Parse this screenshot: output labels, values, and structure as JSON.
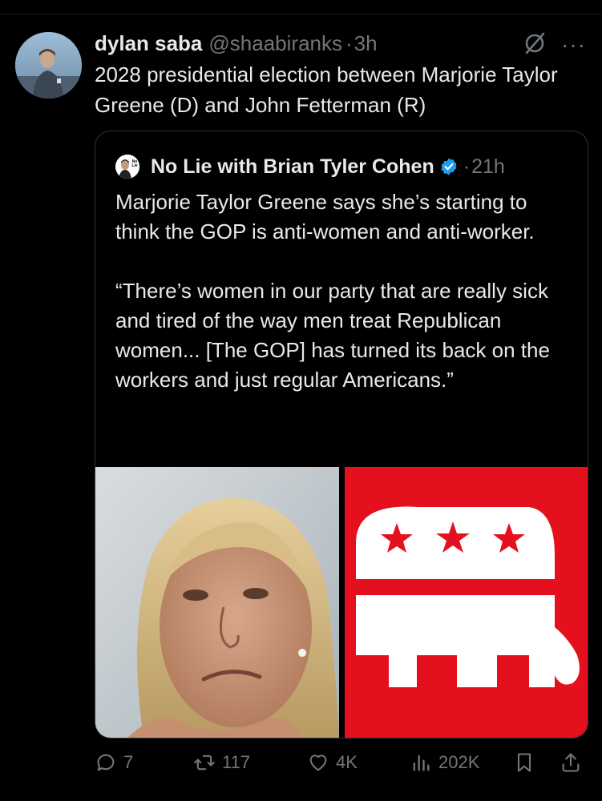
{
  "tweet": {
    "author_name": "dylan saba",
    "author_handle": "@shaabiranks",
    "separator": "·",
    "time": "3h",
    "text": "2028 presidential election between Marjorie Taylor Greene (D) and John Fetterman (R)",
    "more_icon": "more-horizontal-icon",
    "grok_icon": "grok-icon"
  },
  "quote": {
    "author_name": "No Lie with Brian Tyler Cohen",
    "separator": "·",
    "time": "21h",
    "paragraph1": "Marjorie Taylor Greene says she’s starting to think the GOP is anti-women and anti-worker.",
    "paragraph2": "“There’s women in our party that are really sick and tired of the way men treat Republican women...  [The GOP] has turned its back on the workers and just regular Americans.”",
    "avatar_logo_text": "No Lie",
    "verified_color": "#1d9bf0"
  },
  "actions": {
    "replies": "7",
    "reposts": "117",
    "likes": "4K",
    "views": "202K"
  },
  "colors": {
    "background": "#000000",
    "text": "#e7e9ea",
    "muted": "#71767b",
    "gop_red": "#e4101e"
  }
}
